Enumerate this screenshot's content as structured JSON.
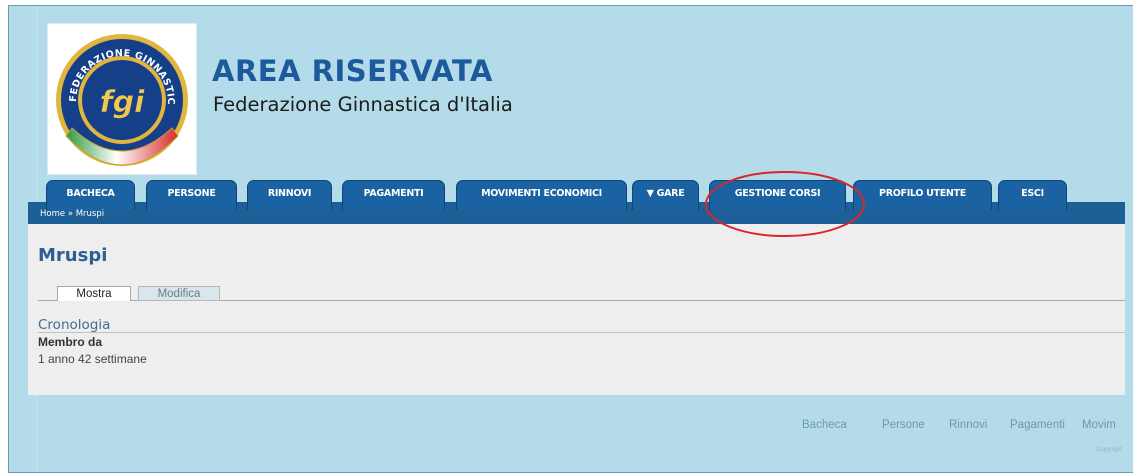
{
  "header": {
    "logo_text": "FEDERAZIONE GINNASTICA D'ITALIA",
    "logo_mark": "fgi",
    "title": "AREA RISERVATA",
    "subtitle": "Federazione Ginnastica d'Italia"
  },
  "nav": {
    "tabs": [
      {
        "label": "BACHECA"
      },
      {
        "label": "PERSONE"
      },
      {
        "label": "RINNOVI"
      },
      {
        "label": "PAGAMENTI"
      },
      {
        "label": "MOVIMENTI ECONOMICI"
      },
      {
        "label": "▼ GARE"
      },
      {
        "label": "GESTIONE CORSI"
      },
      {
        "label": "PROFILO UTENTE"
      },
      {
        "label": "ESCI"
      }
    ],
    "highlighted_tab": "GESTIONE CORSI"
  },
  "breadcrumb": {
    "home": "Home",
    "separator": "»",
    "current": "Mruspi"
  },
  "main": {
    "page_title": "Mruspi",
    "view_tabs": [
      {
        "label": "Mostra",
        "active": true
      },
      {
        "label": "Modifica",
        "active": false
      }
    ],
    "section_title": "Cronologia",
    "field_label": "Membro da",
    "field_value": "1 anno 42 settimane"
  },
  "footer": {
    "links": [
      "Bacheca",
      "Persone",
      "Rinnovi",
      "Pagamenti",
      "Movim"
    ],
    "copyright": "Copyright"
  },
  "colors": {
    "page_bg": "#b3dbe9",
    "tab_blue": "#1a62a1",
    "title_blue": "#1d5a9c",
    "content_bg": "#eeeeee",
    "annotation_red": "#d8262b"
  }
}
